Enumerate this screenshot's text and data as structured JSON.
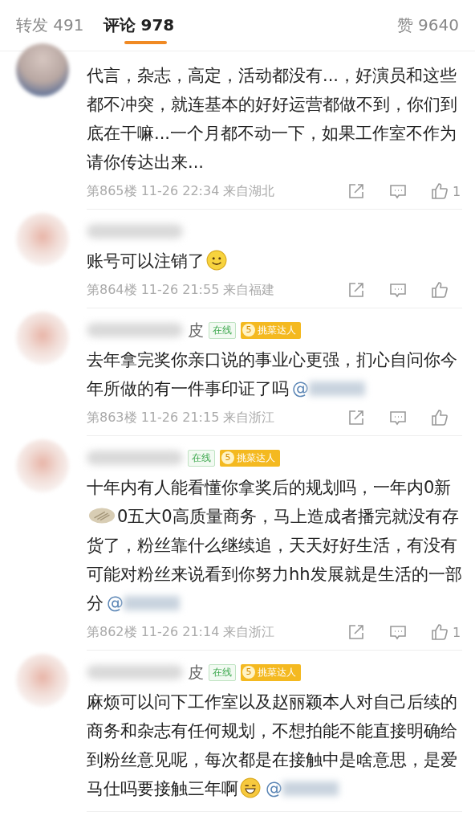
{
  "tabs": [
    {
      "label": "转发 491",
      "selected": false
    },
    {
      "label": "评论 978",
      "selected": true
    },
    {
      "label": "赞 9640",
      "selected": false
    }
  ],
  "comments": [
    {
      "kind": "partial",
      "body": [
        {
          "kind": "text",
          "text": "代言，杂志，高定，活动都没有...，好演员和这些都不冲突，就连基本的好好运营都做不到，你们到底在干嘛...一个月都不动一下，如果工作室不作为请你传达出来..."
        }
      ],
      "floor": "第865楼",
      "time": "11-26 22:34",
      "location": "来自湖北",
      "likes": "1"
    },
    {
      "kind": "full",
      "body": [
        {
          "kind": "text",
          "text": "账号可以注销了"
        },
        {
          "kind": "smile"
        }
      ],
      "floor": "第864楼",
      "time": "11-26 21:55",
      "location": "来自福建"
    },
    {
      "kind": "full",
      "name_visible": "皮",
      "badges": [
        {
          "kind": "online",
          "label": "在线"
        },
        {
          "kind": "level",
          "level_num": "5",
          "label": "挑菜达人"
        }
      ],
      "body": [
        {
          "kind": "text",
          "text": "去年拿完奖你亲口说的事业心更强，扪心自问你今年所做的有一件事印证了吗"
        },
        {
          "kind": "mention",
          "text": "@"
        }
      ],
      "floor": "第863楼",
      "time": "11-26 21:15",
      "location": "来自浙江"
    },
    {
      "kind": "full",
      "badges": [
        {
          "kind": "online",
          "label": "在线"
        },
        {
          "kind": "level",
          "level_num": "5",
          "label": "挑菜达人"
        }
      ],
      "body": [
        {
          "kind": "text",
          "text": "十年内有人能看懂你拿奖后的规划吗，一年内0新"
        },
        {
          "kind": "dumpling"
        },
        {
          "kind": "text",
          "text": "0五大0高质量商务，马上造成者播完就没有存货了，粉丝靠什么继续追，天天好好生活，有没有可能对粉丝来说看到你努力hh发展就是生活的一部分"
        },
        {
          "kind": "mention",
          "text": "@"
        }
      ],
      "floor": "第862楼",
      "time": "11-26 21:14",
      "location": "来自浙江",
      "likes": "1"
    },
    {
      "kind": "full",
      "name_visible": "皮",
      "badges": [
        {
          "kind": "online",
          "label": "在线"
        },
        {
          "kind": "level",
          "level_num": "5",
          "label": "挑菜达人"
        }
      ],
      "body": [
        {
          "kind": "text",
          "text": "麻烦可以问下工作室以及赵丽颖本人对自己后续的商务和杂志有任何规划，不想拍能不能直接明确给到粉丝意见呢，每次都是在接触中是啥意思，是爱马仕吗要接触三年啊"
        },
        {
          "kind": "grin"
        },
        {
          "kind": "mention",
          "text": "@"
        }
      ]
    }
  ]
}
